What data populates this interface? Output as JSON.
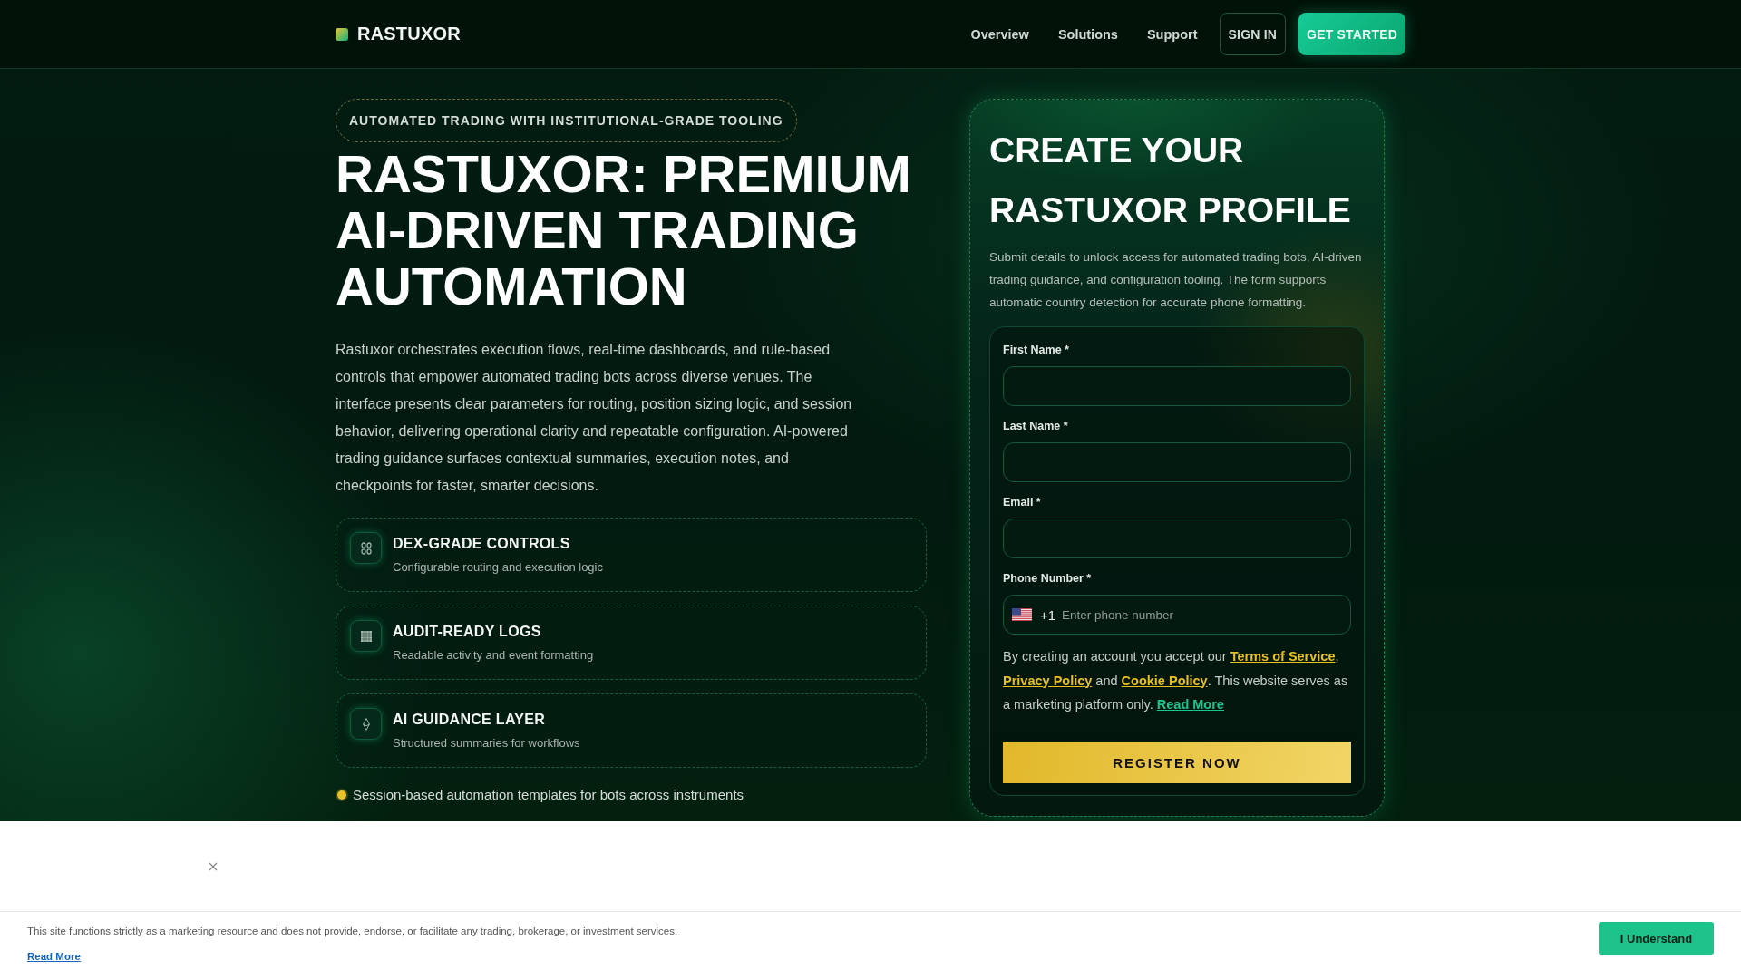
{
  "header": {
    "logo": "RASTUXOR",
    "nav": [
      "Overview",
      "Solutions",
      "Support"
    ],
    "sign_in": "SIGN IN",
    "get_started": "GET STARTED"
  },
  "hero": {
    "badge": "AUTOMATED TRADING WITH INSTITUTIONAL-GRADE TOOLING",
    "title": "RASTUXOR: PREMIUM AI-DRIVEN TRADING AUTOMATION",
    "description": "Rastuxor orchestrates execution flows, real-time dashboards, and rule-based controls that empower automated trading bots across diverse venues. The interface presents clear parameters for routing, position sizing logic, and session behavior, delivering operational clarity and repeatable configuration. AI-powered trading guidance surfaces contextual summaries, execution notes, and checkpoints for faster, smarter decisions.",
    "features": [
      {
        "title": "DEX-GRADE CONTROLS",
        "subtitle": "Configurable routing and execution logic"
      },
      {
        "title": "AUDIT-READY LOGS",
        "subtitle": "Readable activity and event formatting"
      },
      {
        "title": "AI GUIDANCE LAYER",
        "subtitle": "Structured summaries for workflows"
      }
    ],
    "highlight": "Session-based automation templates for bots across instruments"
  },
  "signup": {
    "title": "CREATE YOUR RASTUXOR PROFILE",
    "description": "Submit details to unlock access for automated trading bots, AI-driven trading guidance, and configuration tooling. The form supports automatic country detection for accurate phone formatting.",
    "fields": [
      {
        "label": "First Name *",
        "kind": "text"
      },
      {
        "label": "Last Name *",
        "kind": "text"
      },
      {
        "label": "Email *",
        "kind": "text"
      },
      {
        "label": "Phone Number *",
        "kind": "phone",
        "dial_code": "+1",
        "placeholder": "Enter phone number"
      }
    ],
    "consent": [
      {
        "kind": "text",
        "text": "By creating an account you accept our "
      },
      {
        "kind": "link",
        "text": "Terms of Service"
      },
      {
        "kind": "text",
        "text": ", "
      },
      {
        "kind": "link",
        "text": "Privacy Policy"
      },
      {
        "kind": "text",
        "text": " and "
      },
      {
        "kind": "link",
        "text": "Cookie Policy"
      },
      {
        "kind": "text",
        "text": ". This website serves as a marketing platform only. "
      },
      {
        "kind": "more",
        "text": "Read More"
      }
    ],
    "submit": "REGISTER NOW"
  },
  "disclaimer": {
    "text": "This site functions strictly as a marketing resource and does not provide, endorse, or facilitate any trading, brokerage, or investment services.",
    "link": "Read More",
    "button": "I Understand"
  }
}
